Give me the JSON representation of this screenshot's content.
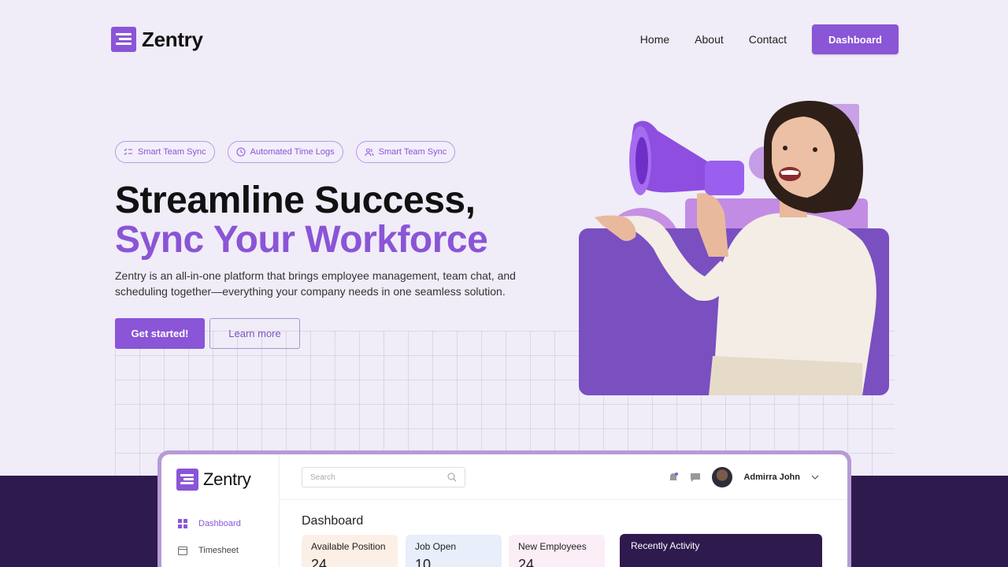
{
  "nav": {
    "brand": "Zentry",
    "links": [
      "Home",
      "About",
      "Contact"
    ],
    "cta": "Dashboard"
  },
  "hero": {
    "pills": [
      {
        "label": "Smart Team Sync",
        "icon": "checklist-icon"
      },
      {
        "label": "Automated Time Logs",
        "icon": "clock-icon"
      },
      {
        "label": "Smart Team Sync",
        "icon": "users-icon"
      }
    ],
    "title_line1": "Streamline Success,",
    "title_line2": "Sync Your Workforce",
    "description": "Zentry is an all-in-one platform that brings employee management, team chat, and scheduling together—everything your company needs in one seamless solution.",
    "primary_button": "Get started!",
    "secondary_button": "Learn more"
  },
  "dashboard": {
    "brand": "Zentry",
    "sidebar": [
      {
        "label": "Dashboard",
        "icon": "grid-icon",
        "active": true
      },
      {
        "label": "Timesheet",
        "icon": "calendar-icon",
        "active": false
      }
    ],
    "search_placeholder": "Search",
    "user_name": "Admirra John",
    "title": "Dashboard",
    "stats": [
      {
        "label": "Available Position",
        "value": "24"
      },
      {
        "label": "Job Open",
        "value": "10"
      },
      {
        "label": "New Employees",
        "value": "24"
      }
    ],
    "activity_title": "Recently Activity"
  },
  "colors": {
    "accent": "#8a55d6",
    "background": "#f0ecf8",
    "dark": "#2f1a4e"
  }
}
